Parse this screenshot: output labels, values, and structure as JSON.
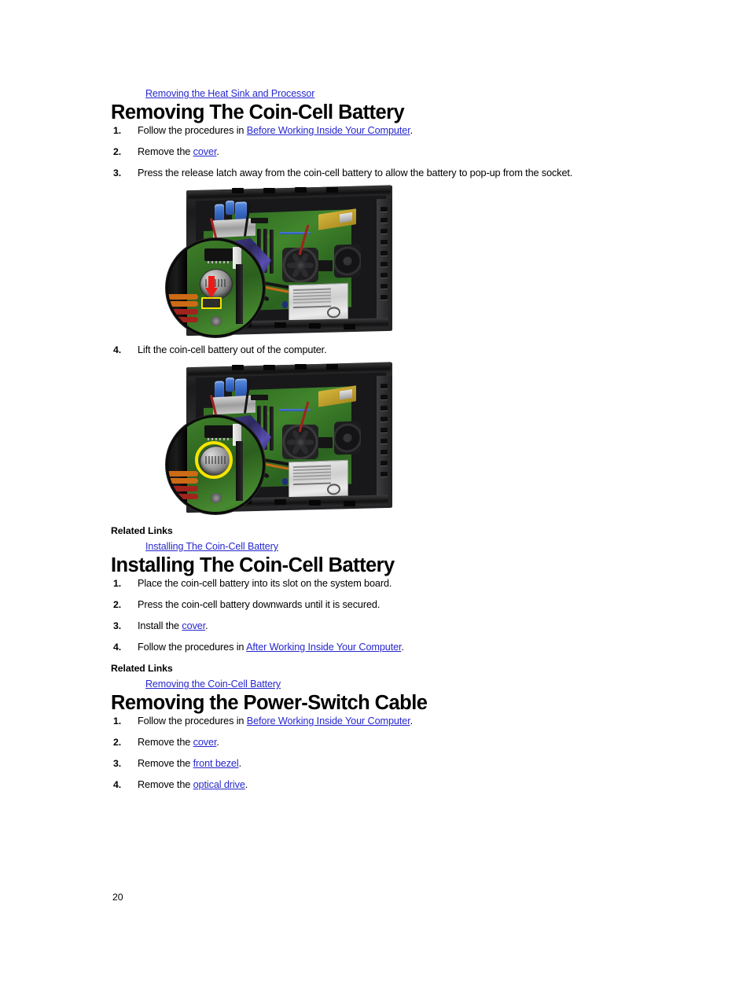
{
  "document": {
    "page_number": "20",
    "link_color": "#2727CF",
    "text_color": "#000000",
    "background_color": "#FFFFFF"
  },
  "top_link": {
    "label": "Removing the Heat Sink and Processor"
  },
  "sections": [
    {
      "id": "removing-coin-cell",
      "heading": "Removing The Coin-Cell Battery",
      "steps": [
        {
          "prefix": "Follow the procedures in ",
          "link": "Before Working Inside Your Computer",
          "suffix": "."
        },
        {
          "prefix": "Remove the ",
          "link": "cover",
          "suffix": "."
        },
        {
          "prefix": "Press the release latch away from the coin-cell battery to allow the battery to pop-up from the socket.",
          "link": "",
          "suffix": ""
        },
        {
          "prefix": "Lift the coin-cell battery out of the computer.",
          "link": "",
          "suffix": ""
        }
      ],
      "related_links_title": "Related Links",
      "related_links": [
        "Installing The Coin-Cell Battery"
      ]
    },
    {
      "id": "installing-coin-cell",
      "heading": "Installing The Coin-Cell Battery",
      "steps": [
        {
          "prefix": "Place the coin-cell battery into its slot on the system board.",
          "link": "",
          "suffix": ""
        },
        {
          "prefix": "Press the coin-cell battery downwards until it is secured.",
          "link": "",
          "suffix": ""
        },
        {
          "prefix": "Install the ",
          "link": "cover",
          "suffix": "."
        },
        {
          "prefix": "Follow the procedures in ",
          "link": "After Working Inside Your Computer",
          "suffix": "."
        }
      ],
      "related_links_title": "Related Links",
      "related_links": [
        "Removing the Coin-Cell Battery"
      ]
    },
    {
      "id": "removing-power-switch-cable",
      "heading": "Removing the Power-Switch Cable",
      "steps": [
        {
          "prefix": "Follow the procedures in ",
          "link": "Before Working Inside Your Computer",
          "suffix": "."
        },
        {
          "prefix": "Remove the ",
          "link": "cover",
          "suffix": "."
        },
        {
          "prefix": "Remove the ",
          "link": "front bezel",
          "suffix": "."
        },
        {
          "prefix": "Remove the ",
          "link": "optical drive",
          "suffix": "."
        }
      ]
    }
  ],
  "figures": [
    {
      "id": "figure-press-release-latch",
      "alt": "Desktop computer chassis interior with magnified circular callout showing a red downward arrow pressing the coin-cell battery release latch highlighted in yellow",
      "callout_marker": "red-arrow",
      "marker_color": "#EA1C17",
      "highlight_color": "#F2E400"
    },
    {
      "id": "figure-lift-coin-cell-battery",
      "alt": "Desktop computer chassis interior with magnified circular callout showing the coin-cell battery circled in yellow",
      "callout_marker": "yellow-circle",
      "marker_color": "#F5E400",
      "highlight_color": "#F5E400"
    }
  ]
}
